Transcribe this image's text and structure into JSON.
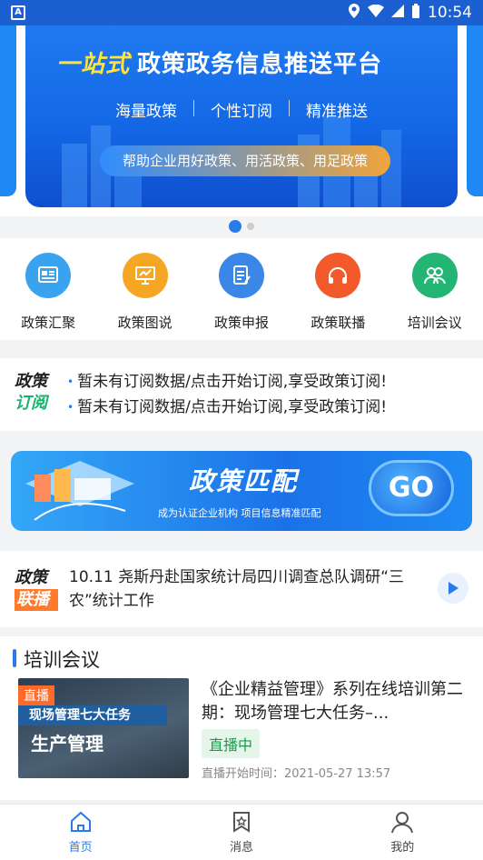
{
  "status_bar": {
    "time": "10:54"
  },
  "banner": {
    "title_highlight": "一站式",
    "title_main": "政策政务信息推送平台",
    "tags": [
      "海量政策",
      "个性订阅",
      "精准推送"
    ],
    "slogan": "帮助企业用好政策、用活政策、用足政策"
  },
  "menu": {
    "items": [
      {
        "label": "政策汇聚",
        "icon": "newspaper-icon",
        "color": "#3aa3f0"
      },
      {
        "label": "政策图说",
        "icon": "presentation-icon",
        "color": "#f5a623"
      },
      {
        "label": "政策申报",
        "icon": "document-edit-icon",
        "color": "#3a87e8"
      },
      {
        "label": "政策联播",
        "icon": "headphones-icon",
        "color": "#f25a2b"
      },
      {
        "label": "培训会议",
        "icon": "group-icon",
        "color": "#22b573"
      }
    ]
  },
  "subscription": {
    "logo_line1": "政策",
    "logo_line2": "订阅",
    "items": [
      "暂未有订阅数据/点击开始订阅,享受政策订阅!",
      "暂未有订阅数据/点击开始订阅,享受政策订阅!"
    ]
  },
  "match_banner": {
    "title": "政策匹配",
    "subtitle": "成为认证企业机构  项目信息精准匹配",
    "go_label": "GO"
  },
  "news": {
    "logo_line1": "政策",
    "logo_line2": "联播",
    "text": "10.11 尧斯丹赴国家统计局四川调查总队调研“三农”统计工作"
  },
  "training": {
    "section_title": "培训会议",
    "thumb_badge": "直播",
    "thumb_bar": "现场管理七大任务",
    "thumb_big": "生产管理",
    "course_title": "《企业精益管理》系列在线培训第二期：现场管理七大任务–...",
    "status": "直播中",
    "time": "直播开始时间：2021-05-27 13:57"
  },
  "tabbar": {
    "items": [
      {
        "label": "首页",
        "icon": "home-icon",
        "active": true
      },
      {
        "label": "消息",
        "icon": "message-icon",
        "active": false
      },
      {
        "label": "我的",
        "icon": "user-icon",
        "active": false
      }
    ]
  },
  "colors": {
    "primary": "#2a7be8",
    "accent": "#ff6a2b",
    "live_green": "#1c9b4c"
  }
}
